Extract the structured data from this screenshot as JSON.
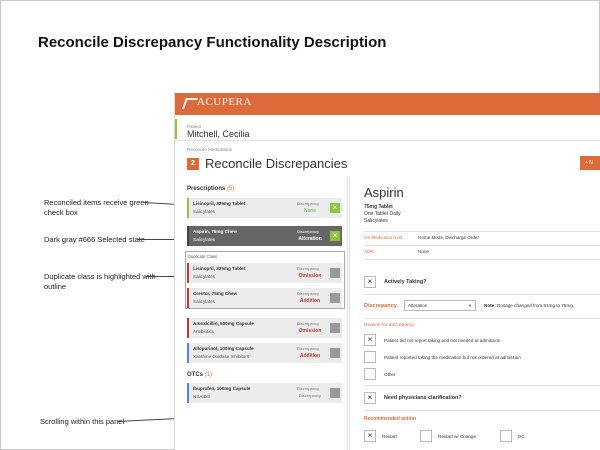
{
  "doc_title": "Reconcile Discrepancy Functionality Description",
  "annotations": [
    {
      "text": "Reconciled items receive green check box"
    },
    {
      "text": "Dark gray #666 Selected state"
    },
    {
      "text": "Duplicate class is highlighted with outline"
    },
    {
      "text": "Scrolling within this panel"
    }
  ],
  "app": {
    "brand": "ACUPERA",
    "patient_label": "Patient",
    "patient_name": "Mitchell, Cecilia",
    "breadcrumb": "Reconcile Medications",
    "step_number": "2",
    "page_title": "Reconcile Discrepancies",
    "add_button": "+ N"
  },
  "left": {
    "prescriptions_title": "Prescriptions",
    "prescriptions_count": "(5)",
    "duplicate_label": "Duplicate Class",
    "otcs_title": "OTCs",
    "otcs_count": "(1)",
    "discrepancy_label": "Discrepancy",
    "cards": [
      {
        "name": "Lisinopril, 325mg Tablet",
        "sub": "Salicylates",
        "status": "None",
        "state": "reconciled"
      },
      {
        "name": "Aspirin, 75mg Chew",
        "sub": "Salicylates",
        "status": "Alteration",
        "state": "selected"
      },
      {
        "name": "Lisinopril, 325mg Tablet",
        "sub": "Salicylates",
        "status": "Omission",
        "state": "open"
      },
      {
        "name": "Crestor, 75mg Chew",
        "sub": "Salicylates",
        "status": "Addition",
        "state": "open"
      },
      {
        "name": "Amoxicillin, 500mg Capsule",
        "sub": "Antibiotics",
        "status": "Omission",
        "state": "open"
      },
      {
        "name": "Allopurinol, 100mg Capsule",
        "sub": "Xanthine Oxidase Inhibitors",
        "status": "Addition",
        "state": "open"
      },
      {
        "name": "Ibuprofen, 100mg Capsule",
        "sub": "NSAIDS",
        "status": "Discrepancy",
        "state": "open"
      }
    ]
  },
  "right": {
    "drug_title": "Aspirin",
    "dose": "75mg Tablet",
    "frequency": "One Tablet Daily",
    "drug_class": "Salicylates",
    "on_med_list_label": "On Medication List",
    "on_med_list_value": "Home Meds, Discharge Order",
    "adr_label": "ADR",
    "adr_value": "None",
    "actively_taking": "Actively Taking?",
    "discrepancy_label": "Discrepancy",
    "discrepancy_value": "Alteration",
    "note_label": "Note:",
    "note_text": "Dosage changed from 81mg to 75mg.",
    "reason_title": "Reason for discrepancy",
    "reasons": [
      {
        "label": "Patient did not report taking and not needed at admission",
        "checked": "×"
      },
      {
        "label": "Patient reported taking the medication but not ordered at admission",
        "checked": ""
      },
      {
        "label": "Other",
        "checked": ""
      }
    ],
    "need_clarification": "Need physicians clarification?",
    "recommended_title": "Recommended action",
    "actions": [
      {
        "label": "Restart",
        "checked": "×"
      },
      {
        "label": "Restart w/ Change",
        "checked": ""
      },
      {
        "label": "DC",
        "checked": ""
      }
    ],
    "check_mark": "×"
  },
  "colors": {
    "accent": "#dd6a3a",
    "reconciled": "#8dc63f",
    "selected": "#666666",
    "omission": "#c0392b"
  }
}
